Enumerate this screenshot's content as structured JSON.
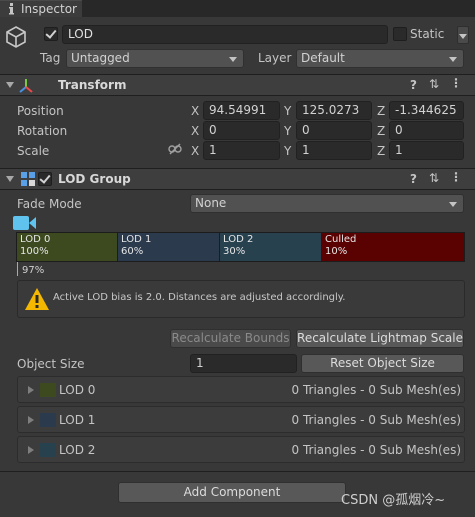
{
  "tab": {
    "label": "Inspector"
  },
  "object": {
    "active": true,
    "name": "LOD",
    "static_label": "Static",
    "static_checked": false,
    "tag_label": "Tag",
    "tag_value": "Untagged",
    "layer_label": "Layer",
    "layer_value": "Default"
  },
  "transform": {
    "title": "Transform",
    "position": {
      "label": "Position",
      "x": "94.54991",
      "y": "125.0273",
      "z": "-1.344625"
    },
    "rotation": {
      "label": "Rotation",
      "x": "0",
      "y": "0",
      "z": "0"
    },
    "scale": {
      "label": "Scale",
      "x": "1",
      "y": "1",
      "z": "1"
    },
    "axis_x": "X",
    "axis_y": "Y",
    "axis_z": "Z"
  },
  "lod_group": {
    "title": "LOD Group",
    "enabled": true,
    "fade_mode_label": "Fade Mode",
    "fade_mode_value": "None",
    "camera_percent": "97%",
    "segments": [
      {
        "name": "LOD 0",
        "percent": "100%",
        "color": "#3d4a1f"
      },
      {
        "name": "LOD 1",
        "percent": "60%",
        "color": "#2c3a4e"
      },
      {
        "name": "LOD 2",
        "percent": "30%",
        "color": "#27414f"
      },
      {
        "name": "Culled",
        "percent": "10%",
        "color": "#5a0202"
      }
    ],
    "warning": "Active LOD bias is 2.0. Distances are adjusted accordingly.",
    "recalc_bounds": "Recalculate Bounds",
    "recalc_lightmap": "Recalculate Lightmap Scale",
    "object_size_label": "Object Size",
    "object_size_value": "1",
    "reset_object_size": "Reset Object Size",
    "levels": [
      {
        "name": "LOD 0",
        "info": "0 Triangles  - 0 Sub Mesh(es)",
        "color": "#3d4a1f"
      },
      {
        "name": "LOD 1",
        "info": "0 Triangles  - 0 Sub Mesh(es)",
        "color": "#2c3a4e"
      },
      {
        "name": "LOD 2",
        "info": "0 Triangles  - 0 Sub Mesh(es)",
        "color": "#27414f"
      }
    ]
  },
  "add_component": "Add Component",
  "watermark": "CSDN @孤烟冷~"
}
